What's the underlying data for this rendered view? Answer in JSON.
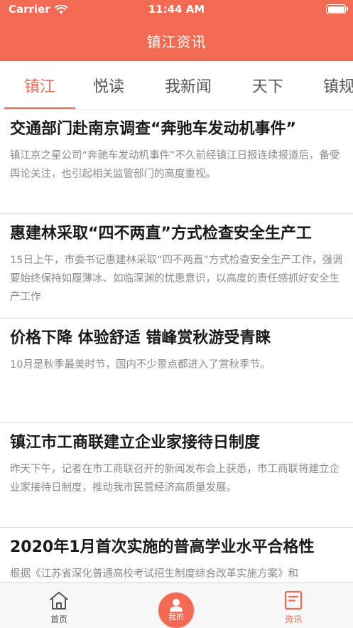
{
  "status_bar": {
    "carrier": "Carrier",
    "time": "11:44 AM"
  },
  "nav": {
    "title": "镇江资讯"
  },
  "tabs": [
    {
      "label": "镇江",
      "active": true
    },
    {
      "label": "悦读",
      "active": false
    },
    {
      "label": "我新闻",
      "active": false
    },
    {
      "label": "天下",
      "active": false
    },
    {
      "label": "镇规",
      "active": false
    }
  ],
  "news": [
    {
      "title": "交通部门赴南京调查“奔驰车发动机事件”",
      "summary": "镇江京之星公司“奔驰车发动机事件”不久前经镇江日报连续报道后，备受舆论关注，也引起相关监管部门的高度重视。"
    },
    {
      "title": "惠建林采取“四不两直”方式检查安全生产工",
      "summary": "15日上午，市委书记惠建林采取“四不两直”方式检查安全生产工作，强调要始终保持如履薄冰、如临深渊的忧患意识，以高度的责任感抓好安全生产工作"
    },
    {
      "title": "价格下降 体验舒适 错峰赏秋游受青睐",
      "summary": "10月是秋季最美时节，国内不少景点都进入了赏秋季节。"
    },
    {
      "title": "镇江市工商联建立企业家接待日制度",
      "summary": "昨天下午，记者在市工商联召开的新闻发布会上获悉，市工商联将建立企业家接待日制度，推动我市民营经济高质量发展。"
    },
    {
      "title": "2020年1月首次实施的普高学业水平合格性",
      "summary": "根据《江苏省深化普通高校考试招生制度综合改革实施方案》和"
    }
  ],
  "tab_bar": {
    "home_label": "首页",
    "me_label": "我的",
    "news_label": "资讯"
  },
  "colors": {
    "accent": "#f26a53",
    "title_text": "#1a1a1a",
    "summary_text": "#8a8a8a"
  }
}
